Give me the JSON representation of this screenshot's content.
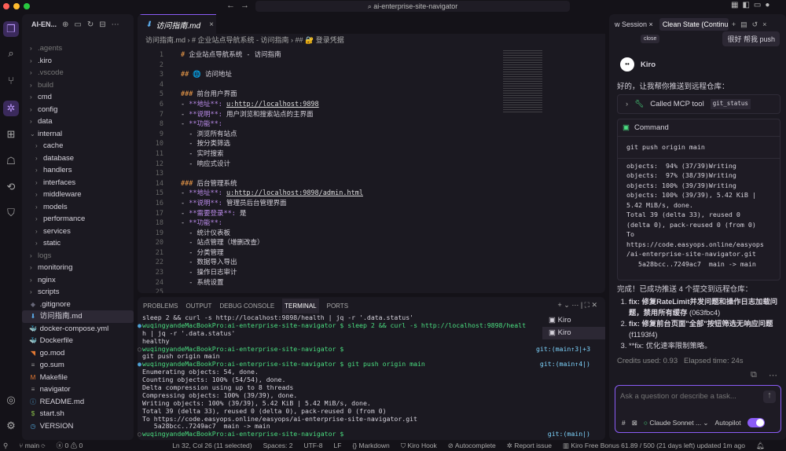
{
  "window": {
    "search": "ai-enterprise-site-navigator"
  },
  "explorer": {
    "title": "AI-EN...",
    "items": [
      {
        "label": ".agents",
        "type": "folder",
        "depth": 0,
        "dim": true
      },
      {
        "label": ".kiro",
        "type": "folder",
        "depth": 0
      },
      {
        "label": ".vscode",
        "type": "folder",
        "depth": 0,
        "dim": true
      },
      {
        "label": "build",
        "type": "folder",
        "depth": 0,
        "dim": true
      },
      {
        "label": "cmd",
        "type": "folder",
        "depth": 0
      },
      {
        "label": "config",
        "type": "folder",
        "depth": 0
      },
      {
        "label": "data",
        "type": "folder",
        "depth": 0
      },
      {
        "label": "internal",
        "type": "folder-open",
        "depth": 0
      },
      {
        "label": "cache",
        "type": "folder",
        "depth": 1
      },
      {
        "label": "database",
        "type": "folder",
        "depth": 1
      },
      {
        "label": "handlers",
        "type": "folder",
        "depth": 1
      },
      {
        "label": "interfaces",
        "type": "folder",
        "depth": 1
      },
      {
        "label": "middleware",
        "type": "folder",
        "depth": 1
      },
      {
        "label": "models",
        "type": "folder",
        "depth": 1
      },
      {
        "label": "performance",
        "type": "folder",
        "depth": 1
      },
      {
        "label": "services",
        "type": "folder",
        "depth": 1
      },
      {
        "label": "static",
        "type": "folder",
        "depth": 1
      },
      {
        "label": "logs",
        "type": "folder",
        "depth": 0,
        "dim": true
      },
      {
        "label": "monitoring",
        "type": "folder",
        "depth": 0
      },
      {
        "label": "nginx",
        "type": "folder",
        "depth": 0
      },
      {
        "label": "scripts",
        "type": "folder",
        "depth": 0
      },
      {
        "label": ".gitignore",
        "type": "file",
        "icon": "◆",
        "color": "#667"
      },
      {
        "label": "访问指南.md",
        "type": "file",
        "icon": "⬇",
        "color": "#5aa9e6",
        "selected": true
      },
      {
        "label": "docker-compose.yml",
        "type": "file",
        "icon": "🐳",
        "color": "#e5537a"
      },
      {
        "label": "Dockerfile",
        "type": "file",
        "icon": "🐳",
        "color": "#4ea1d3"
      },
      {
        "label": "go.mod",
        "type": "file",
        "icon": "◥",
        "color": "#e37933"
      },
      {
        "label": "go.sum",
        "type": "file",
        "icon": "≡",
        "color": "#999"
      },
      {
        "label": "Makefile",
        "type": "file",
        "icon": "M",
        "color": "#e37933"
      },
      {
        "label": "navigator",
        "type": "file",
        "icon": "≡",
        "color": "#999"
      },
      {
        "label": "README.md",
        "type": "file",
        "icon": "ⓘ",
        "color": "#4ea1d3"
      },
      {
        "label": "start.sh",
        "type": "file",
        "icon": "$",
        "color": "#8bc34a"
      },
      {
        "label": "VERSION",
        "type": "file",
        "icon": "◷",
        "color": "#4ea1d3"
      }
    ]
  },
  "editor": {
    "tab": "访问指南.md",
    "breadcrumb": [
      "访问指南.md",
      "# 企业站点导航系统 - 访问指南",
      "## 🔐 登录凭据"
    ],
    "lines": [
      [
        "h",
        "# ",
        "",
        "企业站点导航系统 - 访问指南"
      ],
      [
        "",
        "",
        "",
        ""
      ],
      [
        "h",
        "## ",
        "",
        "🌐 访问地址"
      ],
      [
        "",
        "",
        "",
        ""
      ],
      [
        "h",
        "### ",
        "",
        "前台用户界面"
      ],
      [
        "",
        "- ",
        "**地址**: ",
        "u:http://localhost:9898"
      ],
      [
        "",
        "- ",
        "**说明**: ",
        "用户浏览和搜索站点的主界面"
      ],
      [
        "",
        "- ",
        "**功能**:",
        ""
      ],
      [
        "",
        "  - ",
        "",
        "浏览所有站点"
      ],
      [
        "",
        "  - ",
        "",
        "按分类筛选"
      ],
      [
        "",
        "  - ",
        "",
        "实时搜索"
      ],
      [
        "",
        "  - ",
        "",
        "响应式设计"
      ],
      [
        "",
        "",
        "",
        ""
      ],
      [
        "h",
        "### ",
        "",
        "后台管理系统"
      ],
      [
        "",
        "- ",
        "**地址**: ",
        "u:http://localhost:9898/admin.html"
      ],
      [
        "",
        "- ",
        "**说明**: ",
        "管理员后台管理界面"
      ],
      [
        "",
        "- ",
        "**需要登录**: ",
        "是"
      ],
      [
        "",
        "- ",
        "**功能**:",
        ""
      ],
      [
        "",
        "  - ",
        "",
        "统计仪表板"
      ],
      [
        "",
        "  - ",
        "",
        "站点管理（增删改查）"
      ],
      [
        "",
        "  - ",
        "",
        "分类管理"
      ],
      [
        "",
        "  - ",
        "",
        "数据导入导出"
      ],
      [
        "",
        "  - ",
        "",
        "操作日志审计"
      ],
      [
        "",
        "  - ",
        "",
        "系统设置"
      ],
      [
        "",
        "",
        "",
        ""
      ]
    ]
  },
  "panel": {
    "tabs": [
      "PROBLEMS",
      "OUTPUT",
      "DEBUG CONSOLE",
      "TERMINAL",
      "PORTS"
    ],
    "active": "TERMINAL",
    "terminals": [
      "Kiro",
      "Kiro"
    ],
    "lines": [
      {
        "t": "sleep 2 && curl -s http://localhost:9898/health | jq -r '.data.status'"
      },
      {
        "dot": "●",
        "prompt": "wuqingyandeMacBookPro:ai-enterprise-site-navigator $ ",
        "cmd": "sleep 2 && curl -s http://localhost:9898/healt"
      },
      {
        "t": "h | jq -r '.data.status'"
      },
      {
        "t": "healthy"
      },
      {
        "dot": "○",
        "prompt": "wuqingyandeMacBookPro:ai-enterprise-site-navigator $ ",
        "git": "git:(main↑3|+3"
      },
      {
        "t": "git push origin main"
      },
      {
        "dot": "●",
        "prompt": "wuqingyandeMacBookPro:ai-enterprise-site-navigator $ ",
        "cmd": "git push origin main",
        "git": "git:(main↑4|)"
      },
      {
        "t": "Enumerating objects: 54, done."
      },
      {
        "t": "Counting objects: 100% (54/54), done."
      },
      {
        "t": "Delta compression using up to 8 threads"
      },
      {
        "t": "Compressing objects: 100% (39/39), done."
      },
      {
        "t": "Writing objects: 100% (39/39), 5.42 KiB | 5.42 MiB/s, done."
      },
      {
        "t": "Total 39 (delta 33), reused 0 (delta 0), pack-reused 0 (from 0)"
      },
      {
        "t": "To https://code.easyops.online/easyops/ai-enterprise-site-navigator.git"
      },
      {
        "t": "   5a28bcc..7249ac7  main -> main"
      },
      {
        "dot": "○",
        "prompt": "wuqingyandeMacBookPro:ai-enterprise-site-navigator $ ",
        "git": "git:(main|)"
      }
    ]
  },
  "chat": {
    "tabs": [
      "w Session",
      "Clean State (Continu"
    ],
    "tooltip": "close",
    "user_msg": "很好 帮我 push",
    "agent": "Kiro",
    "intro": "好的，让我帮你推送到远程仓库：",
    "tool_label": "Called MCP tool",
    "tool_name": "git_status",
    "command_title": "Command",
    "command": "git push origin main",
    "output": "objects:  94% (37/39)Writing\nobjects:  97% (38/39)Writing\nobjects: 100% (39/39)Writing\nobjects: 100% (39/39), 5.42 KiB |\n5.42 MiB/s, done.\nTotal 39 (delta 33), reused 0\n(delta 0), pack-reused 0 (from 0)\nTo\nhttps://code.easyops.online/easyops\n/ai-enterprise-site-navigator.git\n   5a28bcc..7249ac7  main -> main",
    "done": "完成！已成功推送 4 个提交到远程仓库：",
    "list": [
      {
        "bold": "fix: 修复RateLimit并发问题和操作日志加载问题，禁用所有缓存",
        "rest": " (063fbc4)"
      },
      {
        "bold": "fix: 修复前台页面\"全部\"按钮筛选无响应问题",
        "rest": " (f1193f4)"
      },
      {
        "bold": "",
        "rest": "**fix: 优化速率限制策略。"
      }
    ],
    "credits": "Credits used: 0.93",
    "elapsed": "Elapsed time: 24s",
    "placeholder": "Ask a question or describe a task...",
    "model": "Claude Sonnet ...",
    "autopilot": "Autopilot",
    "autopilot_on": true
  },
  "status": {
    "branch": "main",
    "errors": "0",
    "warnings": "0",
    "position": "Ln 32, Col 26 (11 selected)",
    "spaces": "Spaces: 2",
    "encoding": "UTF-8",
    "eol": "LF",
    "language": "Markdown",
    "hook": "Kiro Hook",
    "autocomplete": "Autocomplete",
    "report": "Report issue",
    "bonus": "Kiro Free Bonus 61.89 / 500 (21 days left) updated 1m ago"
  }
}
